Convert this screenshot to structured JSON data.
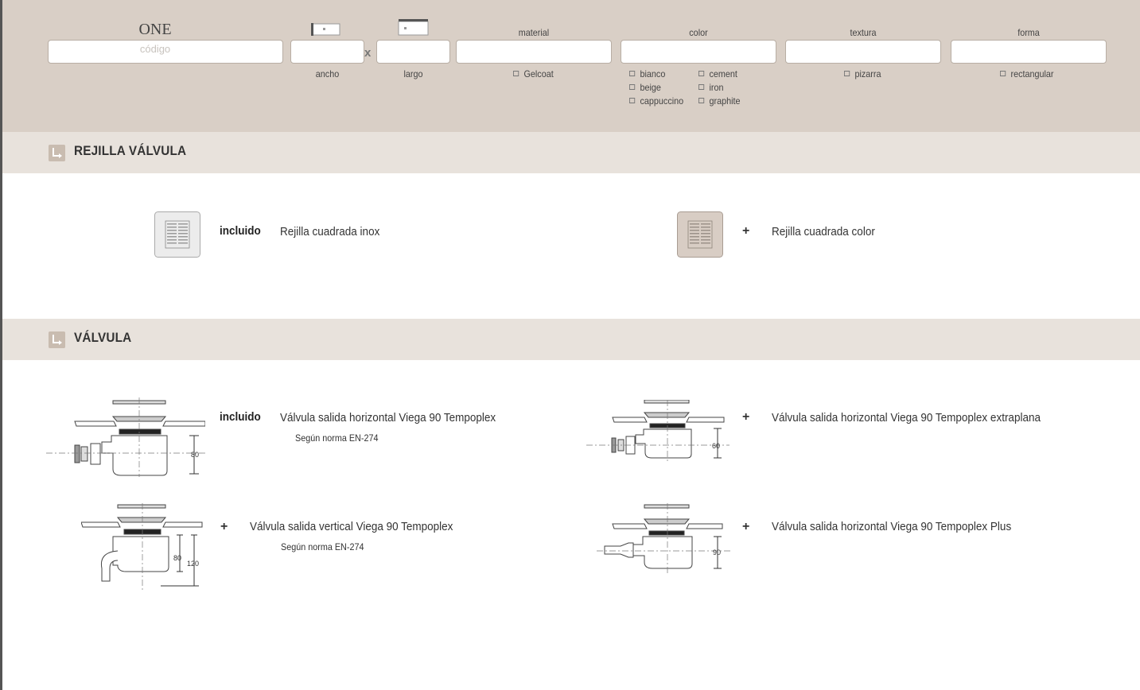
{
  "header": {
    "product_name": "ONE",
    "code_placeholder": "código",
    "width_label": "ancho",
    "length_label": "largo",
    "times_symbol": "x",
    "material": {
      "label": "material",
      "options": [
        "Gelcoat"
      ]
    },
    "color": {
      "label": "color",
      "options": [
        "bianco",
        "beige",
        "cappuccino",
        "cement",
        "iron",
        "graphite"
      ]
    },
    "texture": {
      "label": "textura",
      "options": [
        "pizarra"
      ]
    },
    "shape": {
      "label": "forma",
      "options": [
        "rectangular"
      ]
    }
  },
  "grate_section": {
    "title": "REJILLA VÁLVULA",
    "items": [
      {
        "marker": "incluido",
        "description": "Rejilla cuadrada inox",
        "icon": "grate-inox-icon"
      },
      {
        "marker": "+",
        "description": "Rejilla cuadrada color",
        "icon": "grate-color-icon"
      }
    ]
  },
  "valve_section": {
    "title": "VÁLVULA",
    "items": [
      {
        "marker": "incluido",
        "description": "Válvula salida horizontal Viega 90 Tempoplex",
        "note": "Según norma EN-274",
        "dim_labels": [
          "80"
        ]
      },
      {
        "marker": "+",
        "description": "Válvula salida horizontal Viega 90 Tempoplex extraplana",
        "note": "",
        "dim_labels": [
          "60"
        ]
      },
      {
        "marker": "+",
        "description": "Válvula salida vertical Viega 90 Tempoplex",
        "note": "Según norma EN-274",
        "dim_labels": [
          "80",
          "120"
        ]
      },
      {
        "marker": "+",
        "description": "Válvula salida horizontal Viega 90 Tempoplex Plus",
        "note": "",
        "dim_labels": [
          "90"
        ]
      }
    ]
  },
  "colors": {
    "band": "#d9cfc6",
    "section_header": "#e8e2dc",
    "color_grate": "#d8cdc4"
  }
}
